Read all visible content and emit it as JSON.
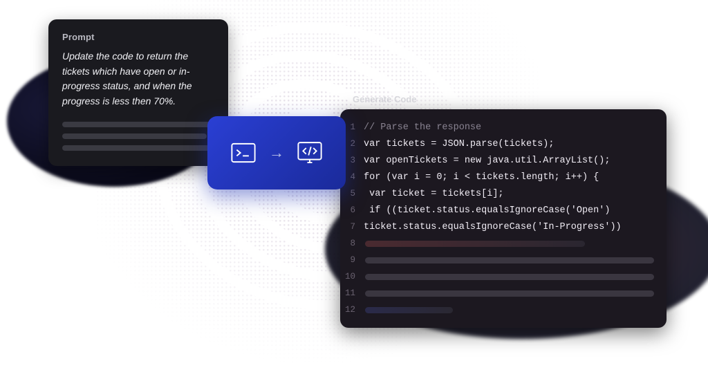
{
  "prompt": {
    "label": "Prompt",
    "text": "Update the code to return the tickets which have open or in-progress status, and when the progress is less then 70%."
  },
  "code": {
    "label": "Generate Code",
    "lines": [
      {
        "n": 1,
        "text": "// Parse the response",
        "cls": "tok-comment"
      },
      {
        "n": 2,
        "text": "var tickets = JSON.parse(tickets);"
      },
      {
        "n": 3,
        "text": "var openTickets = new java.util.ArrayList();"
      },
      {
        "n": 4,
        "text": "for (var i = 0; i < tickets.length; i++) {"
      },
      {
        "n": 5,
        "text": " var ticket = tickets[i];"
      },
      {
        "n": 6,
        "text": " if ((ticket.status.equalsIgnoreCase('Open')"
      },
      {
        "n": 7,
        "text": "ticket.status.equalsIgnoreCase('In-Progress'))"
      }
    ],
    "placeholder_rows": [
      8,
      9,
      10,
      11,
      12
    ]
  },
  "icons": {
    "terminal": "terminal-icon",
    "arrow": "→",
    "code_screen": "code-screen-icon"
  }
}
